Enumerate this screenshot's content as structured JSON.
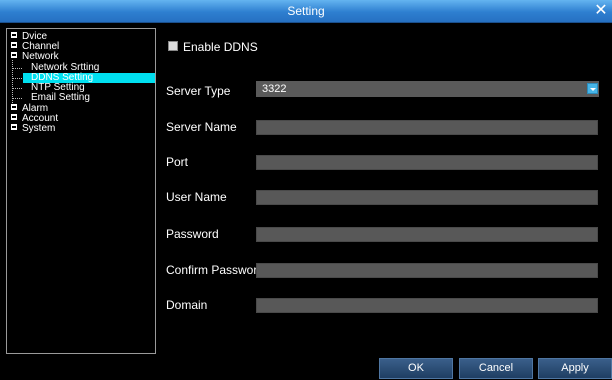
{
  "window": {
    "title": "Setting"
  },
  "tree": {
    "items": [
      {
        "label": "Dvice"
      },
      {
        "label": "Channel"
      },
      {
        "label": "Network"
      },
      {
        "label": "Network Srtting"
      },
      {
        "label": "DDNS Setting"
      },
      {
        "label": "NTP Setting"
      },
      {
        "label": "Email Setting"
      },
      {
        "label": "Alarm"
      },
      {
        "label": "Account"
      },
      {
        "label": "System"
      }
    ]
  },
  "ddns": {
    "enable_label": "Enable DDNS",
    "server_type_label": "Server Type",
    "server_type_value": "3322",
    "server_name_label": "Server Name",
    "port_label": "Port",
    "user_name_label": "User Name",
    "password_label": "Password",
    "confirm_password_label": "Confirm Password",
    "domain_label": "Domain"
  },
  "buttons": {
    "ok": "OK",
    "cancel": "Cancel",
    "apply": "Apply"
  }
}
